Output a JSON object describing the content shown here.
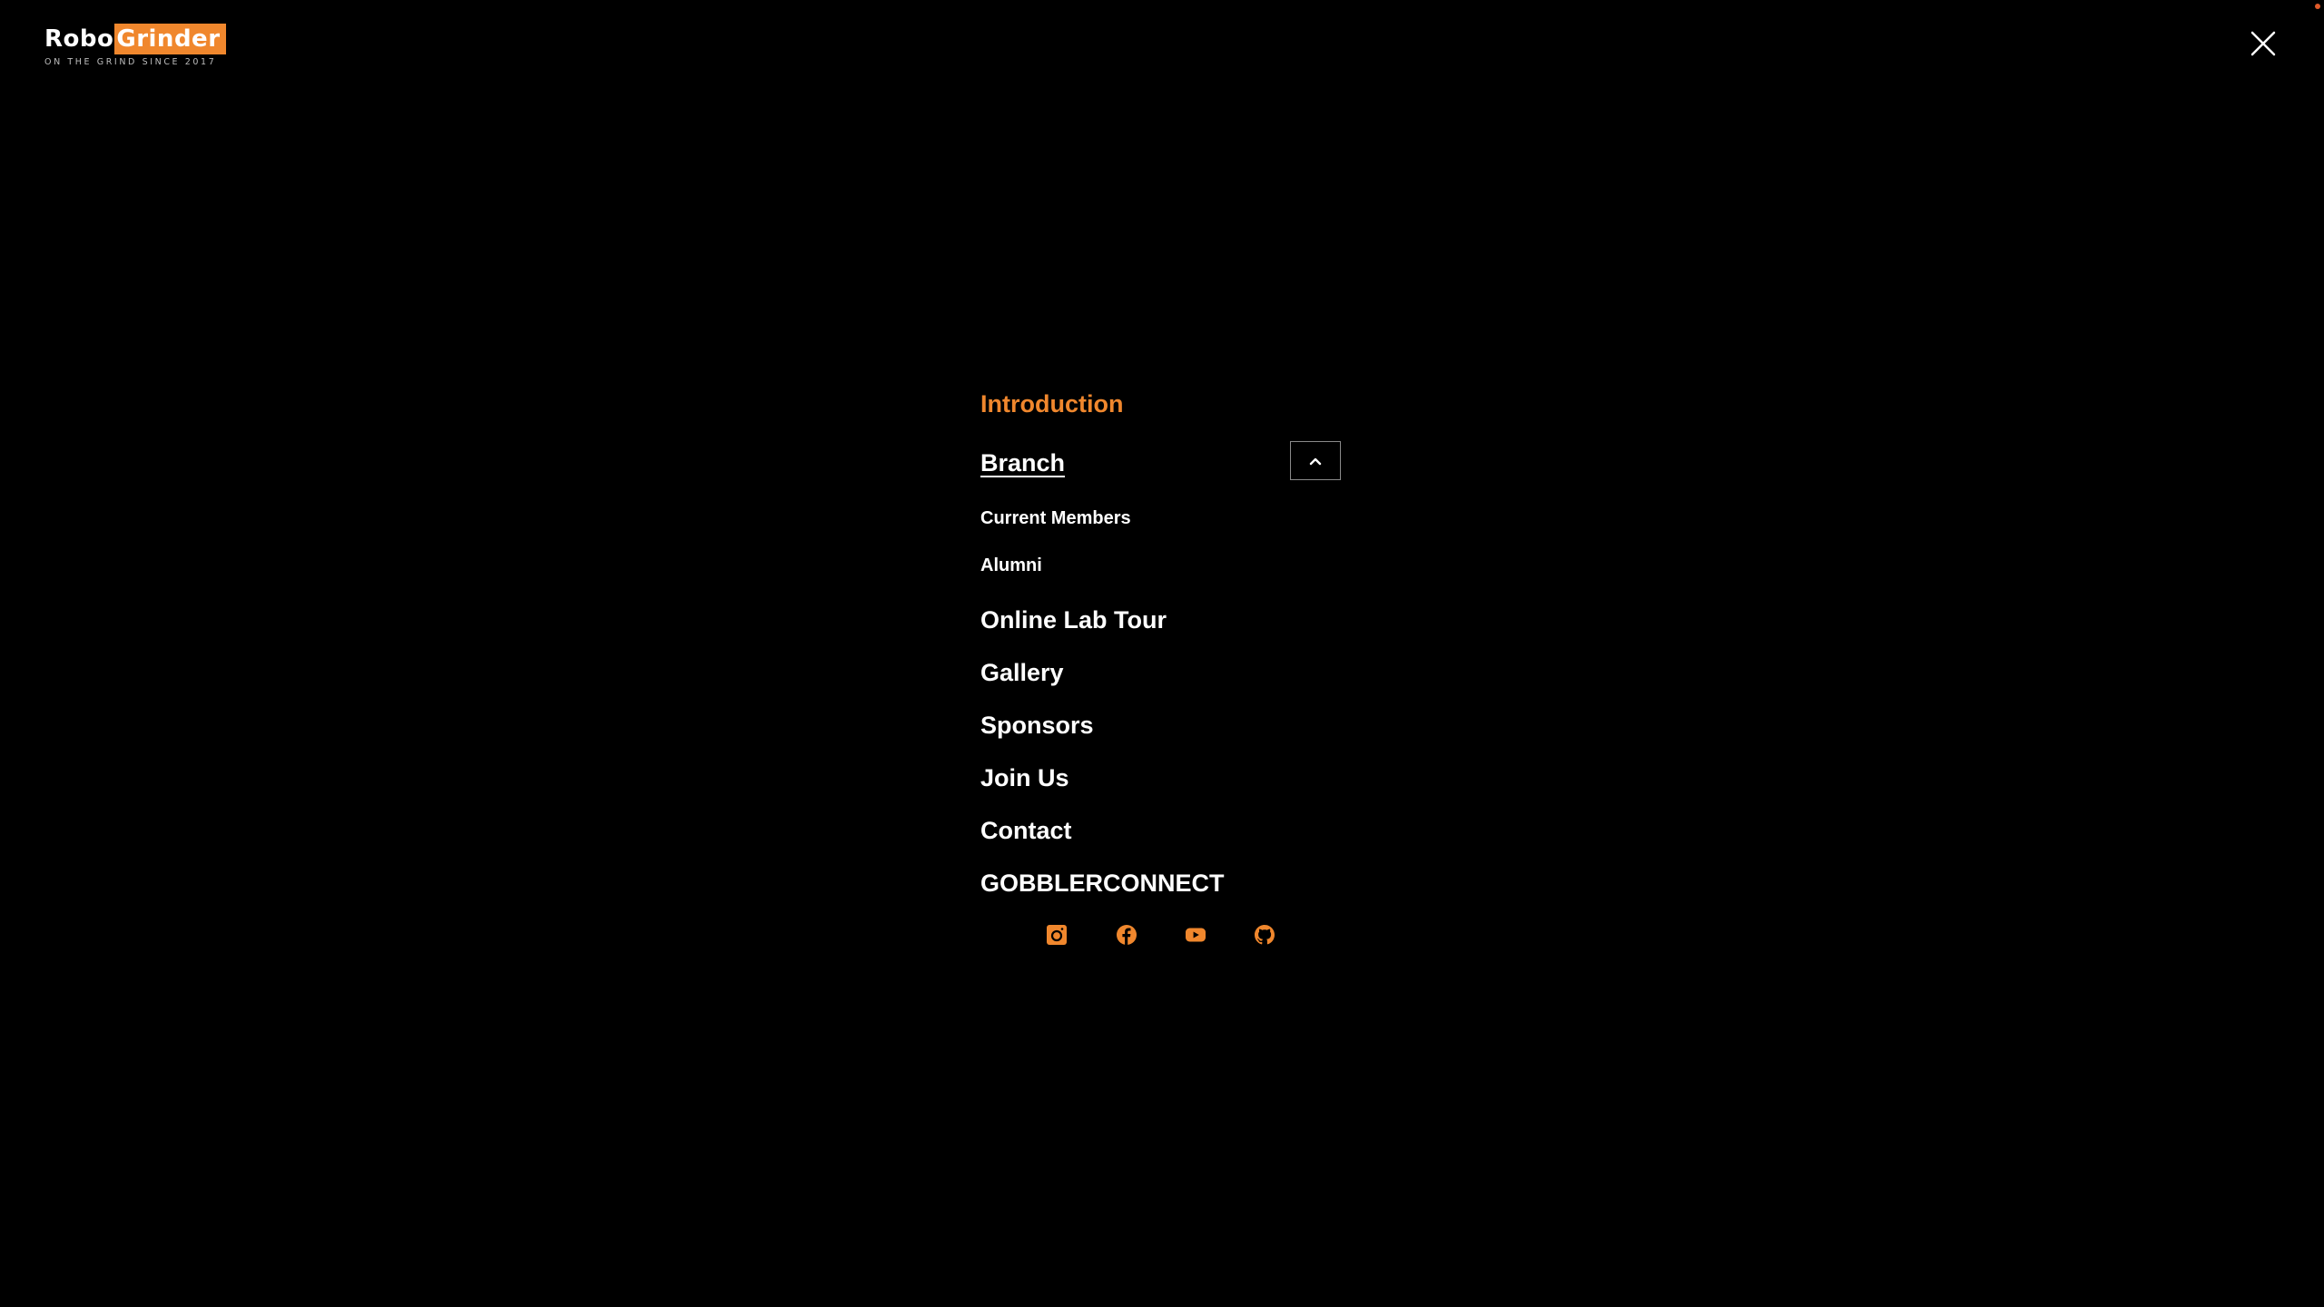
{
  "logo": {
    "part1": "Robo",
    "part2": "Grinder",
    "tagline": "ON THE GRIND SINCE 2017"
  },
  "colors": {
    "accent": "#f0872d",
    "background": "#000000",
    "text": "#ffffff"
  },
  "header": {
    "close_icon": "close-icon"
  },
  "menu": {
    "introduction": "Introduction",
    "branch": "Branch",
    "branch_toggle_icon": "chevron-up-icon",
    "branch_sub": {
      "current_members": "Current Members",
      "alumni": "Alumni"
    },
    "online_lab_tour": "Online Lab Tour",
    "gallery": "Gallery",
    "sponsors": "Sponsors",
    "join_us": "Join Us",
    "contact": "Contact",
    "gobblerconnect": "GOBBLERCONNECT"
  },
  "social": {
    "icons": [
      "instagram-icon",
      "facebook-icon",
      "youtube-icon",
      "github-icon"
    ]
  }
}
